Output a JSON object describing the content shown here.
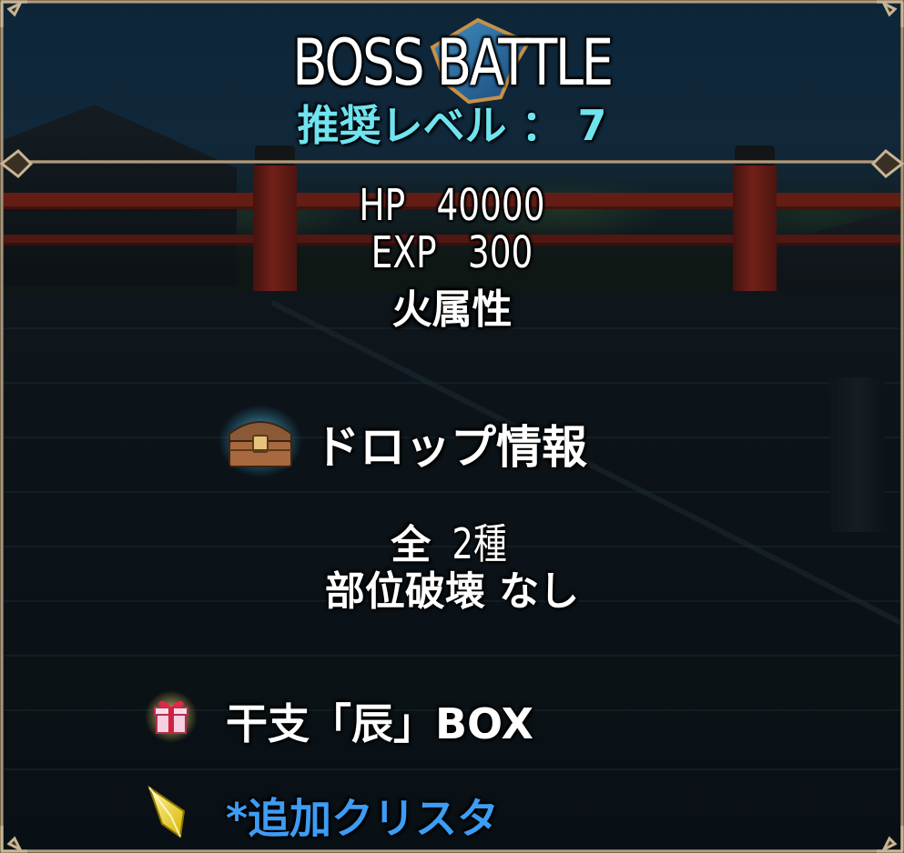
{
  "header": {
    "title": "BOSS BATTLE",
    "recommended_level_label": "推奨レベル",
    "recommended_level_sep": "：",
    "recommended_level_value": "7"
  },
  "stats": {
    "hp_label": "HP",
    "hp_value": "40000",
    "exp_label": "EXP",
    "exp_value": "300",
    "attribute": "火属性"
  },
  "drop": {
    "icon": "treasure-chest-icon",
    "title": "ドロップ情報",
    "total_prefix": "全",
    "total_value": "2種",
    "part_break_label": "部位破壊",
    "part_break_value": "なし"
  },
  "items": [
    {
      "icon": "gift-box-icon",
      "label": "干支「辰」BOX"
    },
    {
      "icon": "crystal-icon",
      "label": "*追加クリスタ"
    }
  ],
  "colors": {
    "level_text": "#6fe3f0",
    "crystal_text": "#3d9cf4",
    "frame": "#c9b595",
    "rail": "#8a2418"
  }
}
